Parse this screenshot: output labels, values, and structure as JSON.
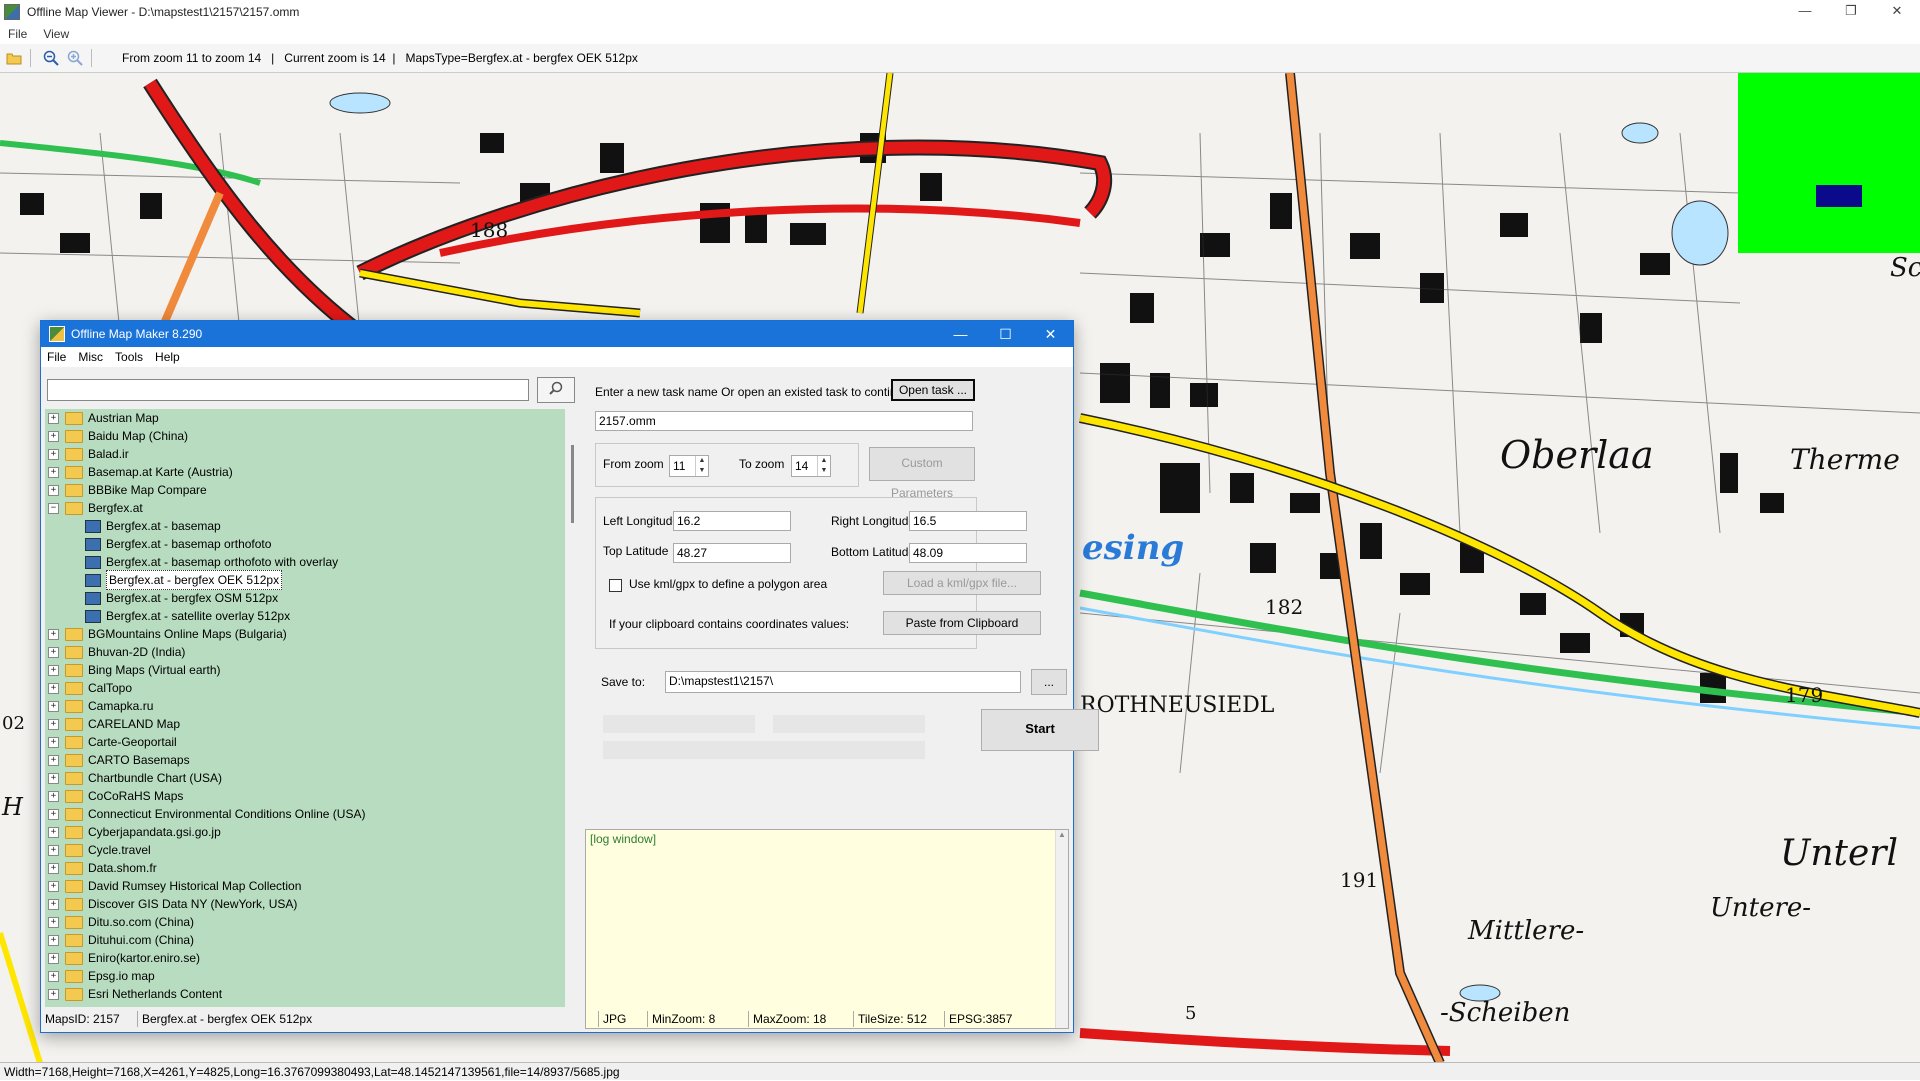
{
  "window": {
    "title": "Offline Map Viewer - D:\\mapstest1\\2157\\2157.omm",
    "controls": [
      "—",
      "❐",
      "✕"
    ]
  },
  "menu": [
    "File",
    "View"
  ],
  "toolbar": {
    "status_text": "From zoom 11 to zoom 14   |   Current zoom is 14  |   MapsType=Bergfex.at - bergfex OEK 512px"
  },
  "map": {
    "labels": [
      "Oberlaa",
      "Therme",
      "Unterl",
      "Untere-",
      "Mittlere-",
      "-Scheiben",
      "ROTHNEUSIEDL",
      "esing",
      "Sch",
      "188",
      "182",
      "191",
      "179",
      "5",
      "02",
      "H"
    ],
    "minimap_color": "#00ff00",
    "minimap_viewport_color": "#0a0a8a"
  },
  "main_status": "Width=7168,Height=7168,X=4261,Y=4825,Long=16.3767099380493,Lat=48.1452147139561,file=14/8937/5685.jpg",
  "dialog": {
    "title": "Offline Map Maker 8.290",
    "controls": [
      "—",
      "☐",
      "✕"
    ],
    "menu": [
      "File",
      "Misc",
      "Tools",
      "Help"
    ],
    "search_value": "",
    "tree": [
      {
        "label": "Austrian Map",
        "expanded": false
      },
      {
        "label": "Baidu Map (China)",
        "expanded": false
      },
      {
        "label": "Balad.ir",
        "expanded": false
      },
      {
        "label": "Basemap.at Karte (Austria)",
        "expanded": false
      },
      {
        "label": "BBBike Map Compare",
        "expanded": false
      },
      {
        "label": "Bergfex.at",
        "expanded": true,
        "children": [
          {
            "label": "Bergfex.at - basemap",
            "selected": false
          },
          {
            "label": "Bergfex.at - basemap orthofoto",
            "selected": false
          },
          {
            "label": "Bergfex.at - basemap orthofoto with overlay",
            "selected": false
          },
          {
            "label": "Bergfex.at - bergfex OEK 512px",
            "selected": true
          },
          {
            "label": "Bergfex.at - bergfex OSM 512px",
            "selected": false
          },
          {
            "label": "Bergfex.at - satellite overlay 512px",
            "selected": false
          }
        ]
      },
      {
        "label": "BGMountains Online Maps (Bulgaria)",
        "expanded": false
      },
      {
        "label": "Bhuvan-2D (India)",
        "expanded": false
      },
      {
        "label": "Bing Maps (Virtual earth)",
        "expanded": false
      },
      {
        "label": "CalTopo",
        "expanded": false
      },
      {
        "label": "Camapka.ru",
        "expanded": false
      },
      {
        "label": "CARELAND Map",
        "expanded": false
      },
      {
        "label": "Carte-Geoportail",
        "expanded": false
      },
      {
        "label": "CARTO Basemaps",
        "expanded": false
      },
      {
        "label": "Chartbundle Chart (USA)",
        "expanded": false
      },
      {
        "label": "CoCoRaHS Maps",
        "expanded": false
      },
      {
        "label": "Connecticut Environmental Conditions Online (USA)",
        "expanded": false
      },
      {
        "label": "Cyberjapandata.gsi.go.jp",
        "expanded": false
      },
      {
        "label": "Cycle.travel",
        "expanded": false
      },
      {
        "label": "Data.shom.fr",
        "expanded": false
      },
      {
        "label": "David Rumsey Historical Map Collection",
        "expanded": false
      },
      {
        "label": "Discover GIS Data NY (NewYork, USA)",
        "expanded": false
      },
      {
        "label": "Ditu.so.com (China)",
        "expanded": false
      },
      {
        "label": "Dituhui.com (China)",
        "expanded": false
      },
      {
        "label": "Eniro(kartor.eniro.se)",
        "expanded": false
      },
      {
        "label": "Epsg.io map",
        "expanded": false
      },
      {
        "label": "Esri Netherlands Content",
        "expanded": false
      }
    ],
    "task_prompt": "Enter a new task name Or open an existed task to continue:",
    "open_task_label": "Open task ...",
    "task_name": "2157.omm",
    "from_zoom_label": "From zoom",
    "from_zoom": "11",
    "to_zoom_label": "To zoom",
    "to_zoom": "14",
    "custom_params_label": "Custom Parameters",
    "left_lon_label": "Left Longitude",
    "left_lon": "16.2",
    "right_lon_label": "Right Longitude",
    "right_lon": "16.5",
    "top_lat_label": "Top Latitude",
    "top_lat": "48.27",
    "bottom_lat_label": "Bottom Latitude",
    "bottom_lat": "48.09",
    "kml_label": "Use kml/gpx to define a polygon area",
    "load_kml_label": "Load a kml/gpx file...",
    "clipboard_prompt": "If your clipboard contains coordinates values:",
    "paste_label": "Paste from Clipboard",
    "save_to_label": "Save to:",
    "save_to": "D:\\mapstest1\\2157\\",
    "browse_label": "...",
    "start_label": "Start",
    "log_text": "[log window]",
    "status": {
      "maps_id": "MapsID: 2157",
      "maps_name": "Bergfex.at - bergfex OEK 512px",
      "format": "JPG",
      "min_zoom": "MinZoom: 8",
      "max_zoom": "MaxZoom: 18",
      "tile_size": "TileSize: 512",
      "epsg": "EPSG:3857"
    }
  }
}
